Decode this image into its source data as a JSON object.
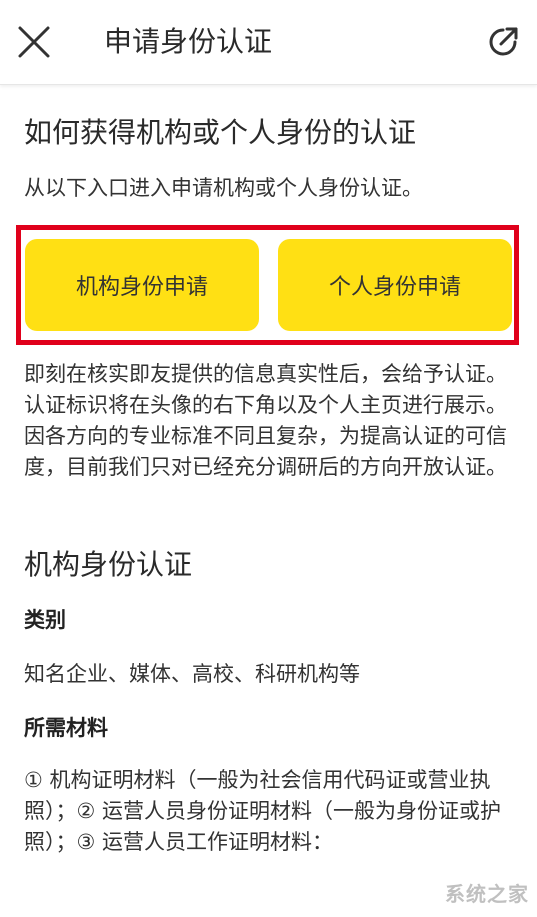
{
  "header": {
    "title": "申请身份认证",
    "close_icon": "close-icon",
    "share_icon": "share-icon"
  },
  "section": {
    "title": "如何获得机构或个人身份的认证",
    "intro": "从以下入口进入申请机构或个人身份认证。",
    "buttons": {
      "org": "机构身份申请",
      "personal": "个人身份申请"
    },
    "description": "即刻在核实即友提供的信息真实性后，会给予认证。认证标识将在头像的右下角以及个人主页进行展示。因各方向的专业标准不同且复杂，为提高认证的可信度，目前我们只对已经充分调研后的方向开放认证。"
  },
  "org_section": {
    "title": "机构身份认证",
    "category_label": "类别",
    "category_text": "知名企业、媒体、高校、科研机构等",
    "materials_label": "所需材料",
    "materials_text": "① 机构证明材料（一般为社会信用代码证或营业执照）；② 运营人员身份证明材料（一般为身份证或护照）；③ 运营人员工作证明材料："
  },
  "watermark": "系统之家",
  "colors": {
    "accent_yellow": "#ffe014",
    "highlight_red": "#e0001b"
  }
}
